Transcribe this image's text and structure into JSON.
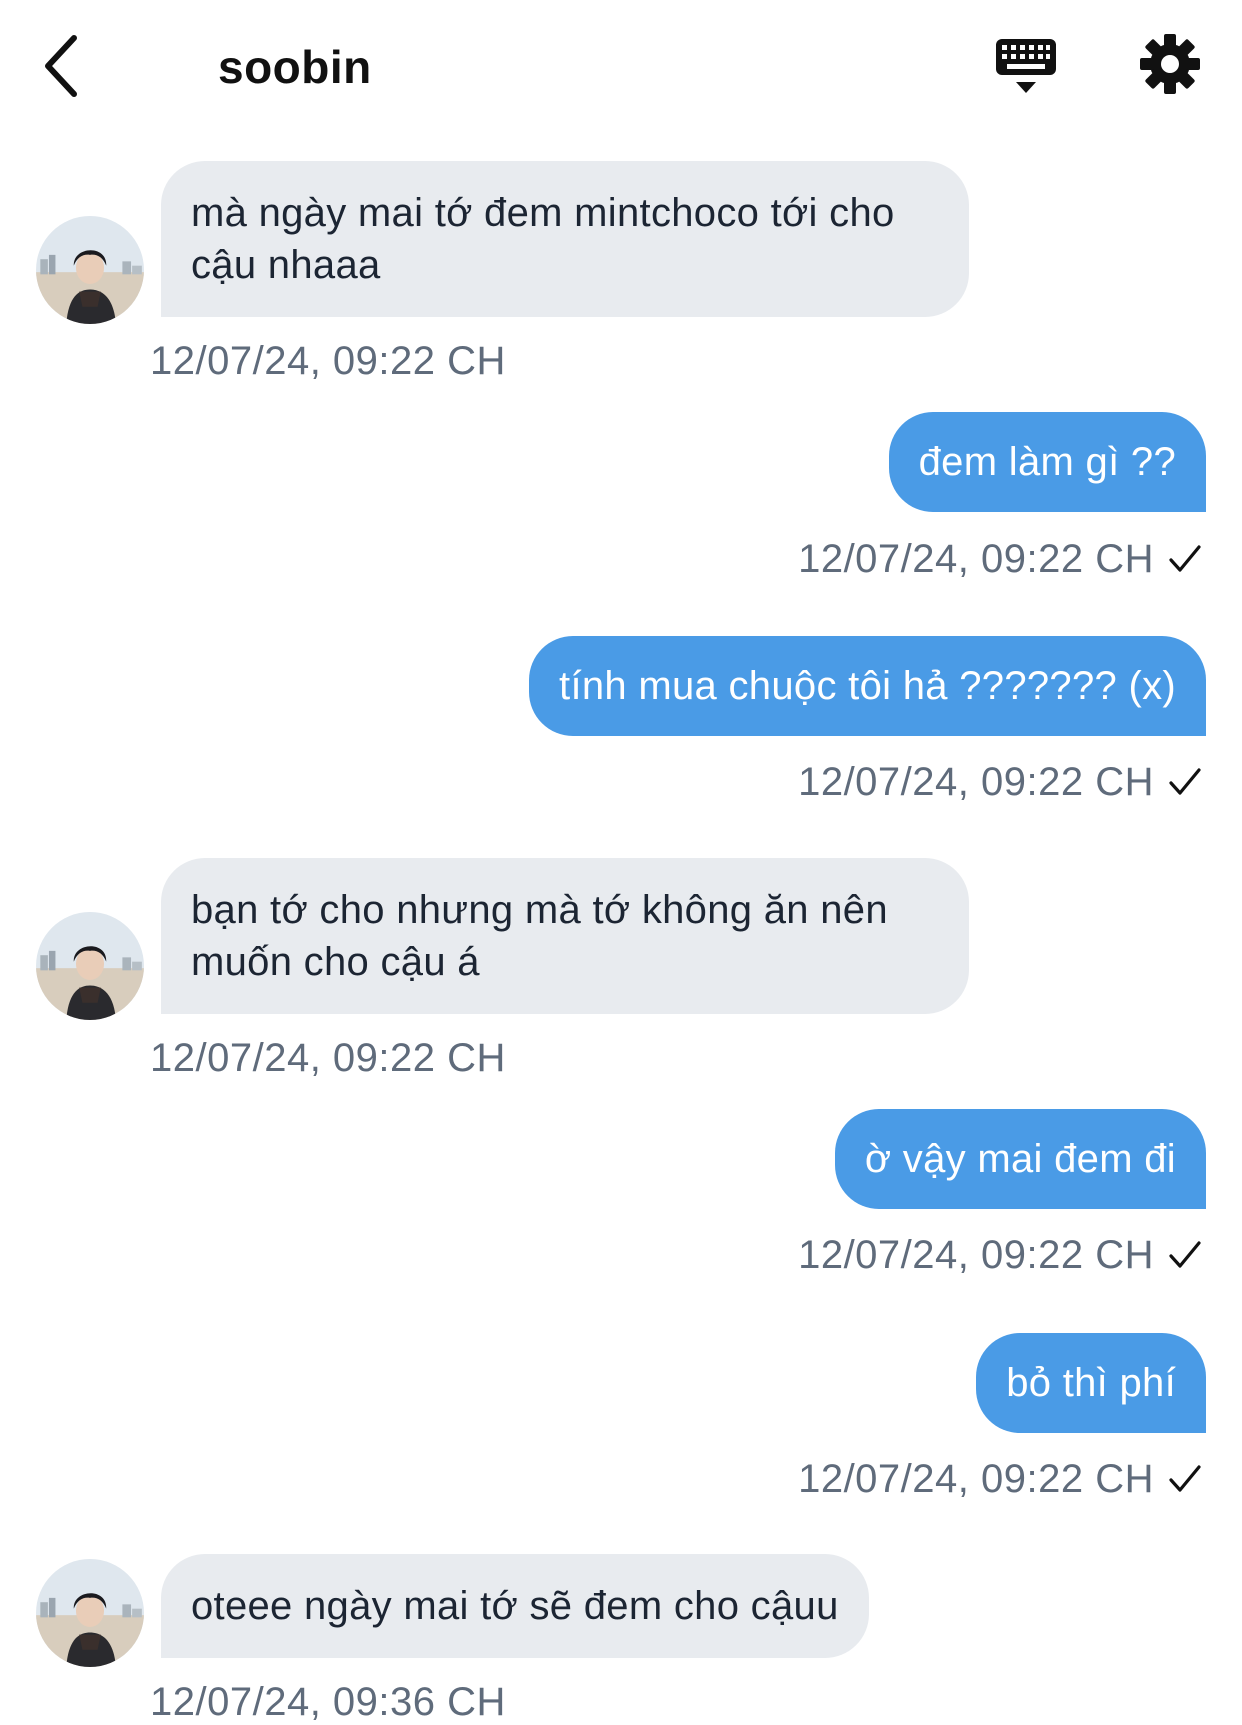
{
  "header": {
    "back_icon": "chevron-left-icon",
    "title": "soobin",
    "keyboard_icon": "keyboard-icon",
    "settings_icon": "gear-icon"
  },
  "colors": {
    "outgoing_bubble": "#4a9be6",
    "incoming_bubble": "#e8ebef",
    "timestamp": "#5f6b7b"
  },
  "messages": [
    {
      "direction": "incoming",
      "text": "mà ngày mai tớ đem mintchoco tới cho cậu nhaaa",
      "time": "12/07/24, 09:22 CH"
    },
    {
      "direction": "outgoing",
      "text": "đem làm gì ??",
      "time": "12/07/24, 09:22 CH",
      "status": "✓"
    },
    {
      "direction": "outgoing",
      "text": "tính mua chuộc tôi hả ??????? (x)",
      "time": "12/07/24, 09:22 CH",
      "status": "✓"
    },
    {
      "direction": "incoming",
      "text": "bạn tớ cho nhưng mà tớ không ăn nên muốn cho cậu á",
      "time": "12/07/24, 09:22 CH"
    },
    {
      "direction": "outgoing",
      "text": "ờ vậy mai đem đi",
      "time": "12/07/24, 09:22 CH",
      "status": "✓"
    },
    {
      "direction": "outgoing",
      "text": "bỏ thì phí",
      "time": "12/07/24, 09:22 CH",
      "status": "✓"
    },
    {
      "direction": "incoming",
      "text": "oteee ngày mai tớ sẽ đem cho cậuu",
      "time": "12/07/24, 09:36 CH"
    }
  ]
}
